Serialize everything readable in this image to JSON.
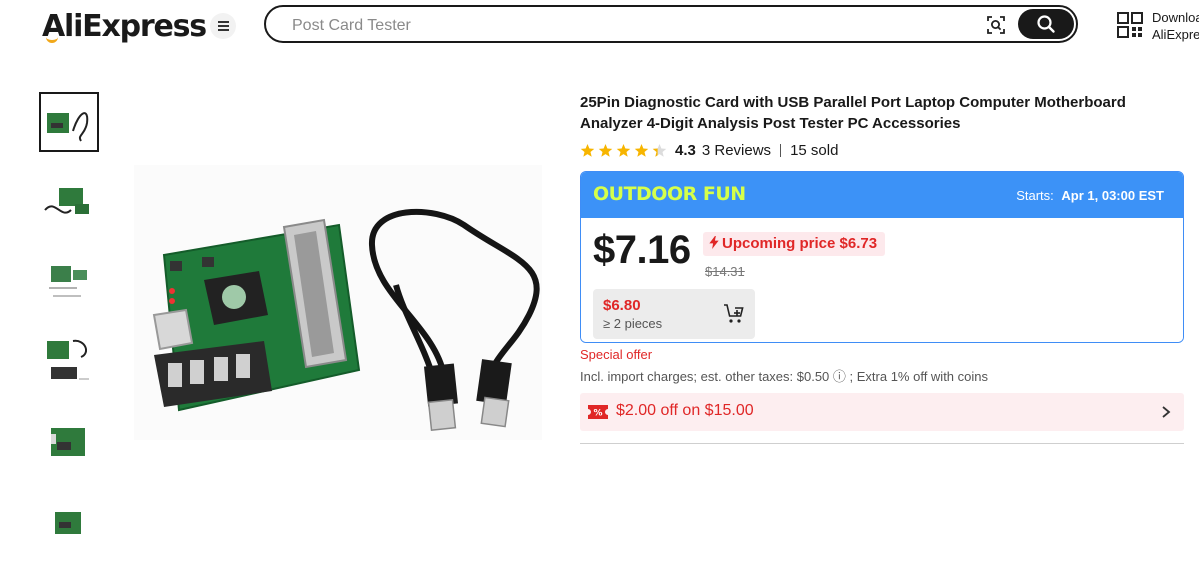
{
  "header": {
    "logo": "AliExpress",
    "search_placeholder": "Post Card Tester",
    "download_line1": "Download",
    "download_line2": "AliExpress app"
  },
  "icons": {
    "menu": "hamburger-icon",
    "scan": "image-search-icon",
    "search": "search-icon",
    "qr": "qr-code-icon",
    "cart": "add-to-cart-icon",
    "coupon": "coupon-icon",
    "chevron": "chevron-right-icon",
    "upcoming": "lightning-icon"
  },
  "product": {
    "title": "25Pin Diagnostic Card with USB Parallel Port Laptop Computer Motherboard Analyzer 4-Digit Analysis Post Tester PC Accessories",
    "rating": "4.3",
    "rating_stars": 4.3,
    "reviews": "3 Reviews",
    "sold": "15 sold",
    "thumbnail_count": 6
  },
  "promo": {
    "name": "OUTDOOR FUN",
    "starts_label": "Starts:",
    "starts_value": "Apr 1, 03:00 EST"
  },
  "pricing": {
    "price": "$7.16",
    "upcoming_text": "Upcoming price $6.73",
    "original_price": "$14.31",
    "bulk_price": "$6.80",
    "bulk_qty": "≥ 2 pieces"
  },
  "offers": {
    "special": "Special offer",
    "taxes": "Incl. import charges; est. other taxes: $0.50 ⓘ ; Extra 1% off with coins",
    "coupon": "$2.00 off on $15.00"
  },
  "colors": {
    "accent_red": "#e02727",
    "promo_blue": "#3c92f7",
    "promo_text": "#d6ff4a",
    "star": "#f7b500"
  }
}
